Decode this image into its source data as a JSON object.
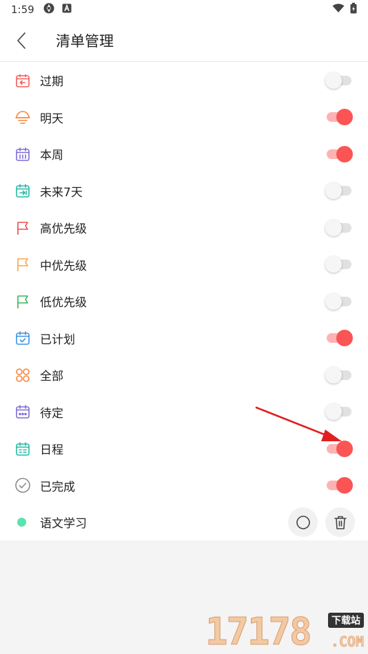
{
  "status_bar": {
    "time": "1:59"
  },
  "header": {
    "title": "清单管理"
  },
  "colors": {
    "accent": "#fb5454",
    "toggle_on_track": "#ffb2b2",
    "toggle_off_track": "#e1e1e1"
  },
  "items": [
    {
      "label": "过期",
      "icon": "calendar-overdue-icon",
      "color": "#f25b5b",
      "enabled": false
    },
    {
      "label": "明天",
      "icon": "sunrise-icon",
      "color": "#f7853a",
      "enabled": true
    },
    {
      "label": "本周",
      "icon": "calendar-week-icon",
      "color": "#7d6bd8",
      "enabled": true
    },
    {
      "label": "未来7天",
      "icon": "calendar-next-icon",
      "color": "#22b8a6",
      "enabled": false
    },
    {
      "label": "高优先级",
      "icon": "flag-icon",
      "color": "#ef4a4a",
      "enabled": false
    },
    {
      "label": "中优先级",
      "icon": "flag-icon",
      "color": "#f6a64b",
      "enabled": false
    },
    {
      "label": "低优先级",
      "icon": "flag-icon",
      "color": "#3db35a",
      "enabled": false
    },
    {
      "label": "已计划",
      "icon": "calendar-check-icon",
      "color": "#3a92e0",
      "enabled": true
    },
    {
      "label": "全部",
      "icon": "four-circles-icon",
      "color": "#f7853a",
      "enabled": false
    },
    {
      "label": "待定",
      "icon": "calendar-dots-icon",
      "color": "#7d6bd8",
      "enabled": false
    },
    {
      "label": "日程",
      "icon": "calendar-schedule-icon",
      "color": "#22b8a6",
      "enabled": true
    },
    {
      "label": "已完成",
      "icon": "check-circle-icon",
      "color": "#8a8a8a",
      "enabled": true
    }
  ],
  "custom_list": {
    "label": "语文学习",
    "dot_color": "#5ce2ae"
  },
  "watermark": {
    "digits": "17178",
    "badge": "下载站",
    "suffix": ".COM"
  }
}
